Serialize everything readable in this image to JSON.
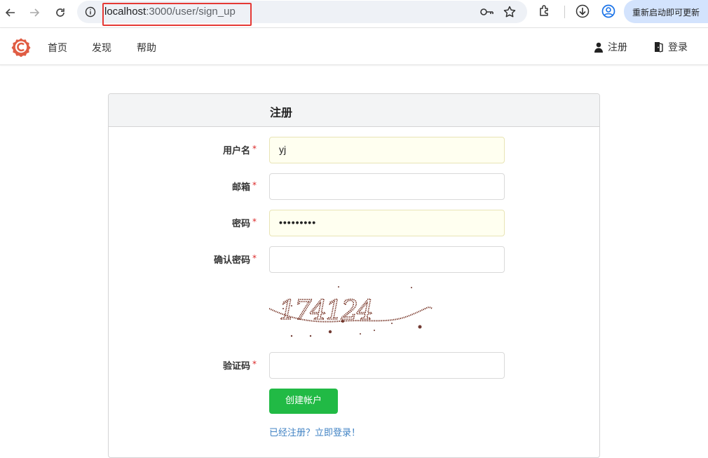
{
  "browser": {
    "url_host": "localhost",
    "url_path": ":3000/user/sign_up",
    "update_label": "重新启动即可更新"
  },
  "nav": {
    "home": "首页",
    "explore": "发现",
    "help": "帮助",
    "register": "注册",
    "login": "登录"
  },
  "form": {
    "title": "注册",
    "username_label": "用户名",
    "username_value": "yj",
    "email_label": "邮箱",
    "email_value": "",
    "password_label": "密码",
    "password_value": "•••••••••",
    "confirm_label": "确认密码",
    "confirm_value": "",
    "captcha_text": "174124",
    "captcha_label": "验证码",
    "captcha_value": "",
    "required_mark": "*",
    "submit_label": "创建帐户",
    "login_link": "已经注册？立即登录！"
  },
  "colors": {
    "accent_green": "#21ba45",
    "link_blue": "#4183c4",
    "required_red": "#db2828",
    "logo_orange": "#e05d44"
  }
}
